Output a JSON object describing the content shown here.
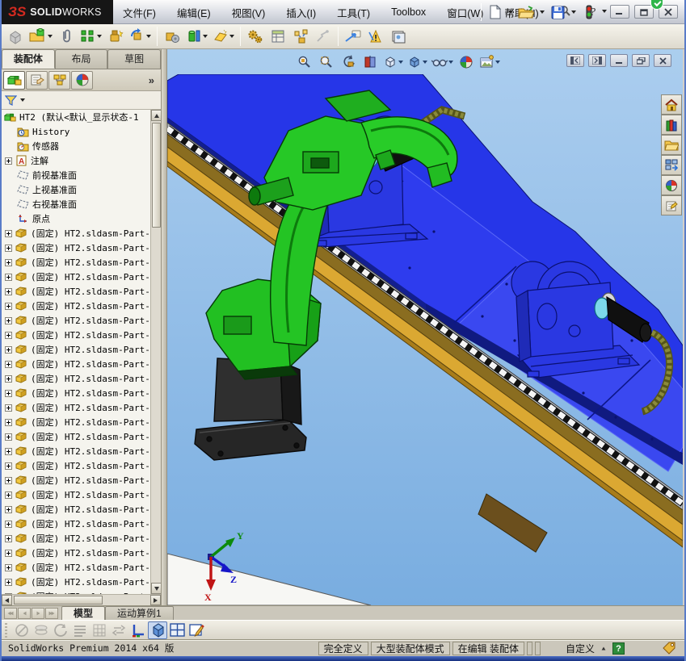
{
  "titlebar": {
    "logo_mark": "ЗS",
    "logo_bold": "SOLID",
    "logo_light": "WORKS",
    "menus": [
      "文件(F)",
      "编辑(E)",
      "视图(V)",
      "插入(I)",
      "工具(T)",
      "Toolbox",
      "窗口(W)",
      "帮助(H)"
    ],
    "quick_icons": [
      "search",
      "new-document",
      "open-document",
      "save",
      "collaboration-lights",
      "help"
    ],
    "window_controls": [
      "minimize",
      "restore",
      "close"
    ]
  },
  "main_toolbar": {
    "icons": [
      "insert-component",
      "open-insert-part",
      "mate",
      "component-pattern",
      "smart-fasteners",
      "rotate-component",
      "move-component",
      "assembly-features",
      "reference-geometry",
      "motion-study",
      "bill-of-materials",
      "exploded-view",
      "explode-line-sketch",
      "interference-detection",
      "assembly-xpert",
      "image-capture"
    ]
  },
  "feature_panel": {
    "tabs": [
      {
        "label": "装配体",
        "active": true
      },
      {
        "label": "布局",
        "active": false
      },
      {
        "label": "草图",
        "active": false
      }
    ],
    "pane_icons": [
      "featuremanager-design-tree",
      "propertymanager",
      "configurationmanager",
      "appearances-dimxpert"
    ],
    "overflow_chevron": "»",
    "tree": {
      "root_label": "HT2  (默认<默认_显示状态-1",
      "items": [
        {
          "label": "History"
        },
        {
          "label": "传感器"
        },
        {
          "label": "注解"
        },
        {
          "label": "前视基准面"
        },
        {
          "label": "上视基准面"
        },
        {
          "label": "右视基准面"
        },
        {
          "label": "原点"
        }
      ],
      "fixed_item_label": "(固定) HT2.sldasm-Part-",
      "fixed_item_count": 26
    }
  },
  "viewport": {
    "headsup_icons": [
      "zoom-to-fit",
      "zoom-to-area",
      "previous-view",
      "section-view",
      "view-orientation",
      "display-style",
      "hide-show-items",
      "edit-appearance",
      "apply-scene"
    ],
    "window_controls": [
      "collapse-pane-left",
      "collapse-pane-right",
      "minimize",
      "restore",
      "close"
    ],
    "triad": {
      "x": "X",
      "y": "Y",
      "z": "Z"
    }
  },
  "task_pane": {
    "icons": [
      "solidworks-resources",
      "design-library",
      "file-explorer",
      "view-palette",
      "appearances-scenes",
      "custom-properties"
    ]
  },
  "bottom_bar": {
    "tabs": [
      {
        "label": "模型",
        "active": true
      },
      {
        "label": "运动算例1",
        "active": false
      }
    ]
  },
  "view_toolbar": {
    "icons": [
      "section-view-off",
      "display-states-off",
      "rotate-view-off",
      "display-list-off",
      "grid-off",
      "reverse-direction-off",
      "coordinate-system",
      "shaded-with-edges",
      "viewport-layout",
      "quick-sketch"
    ]
  },
  "status_bar": {
    "left_text": "SolidWorks Premium 2014 x64 版",
    "cells": [
      "完全定义",
      "大型装配体模式",
      "在编辑 装配体"
    ],
    "customize_label": "自定义",
    "help_badge": "?"
  },
  "colors": {
    "viewport_top": "#abceee",
    "viewport_bottom": "#7aaede",
    "model_blue": "#2636e8",
    "deck_blue": "#3a48f0",
    "robot_green": "#22c022",
    "rail_gold": "#dba832",
    "rail_khaki": "#8a6d20",
    "accent_navy": "#131f8e",
    "cyan_part": "#7cd8ea"
  }
}
